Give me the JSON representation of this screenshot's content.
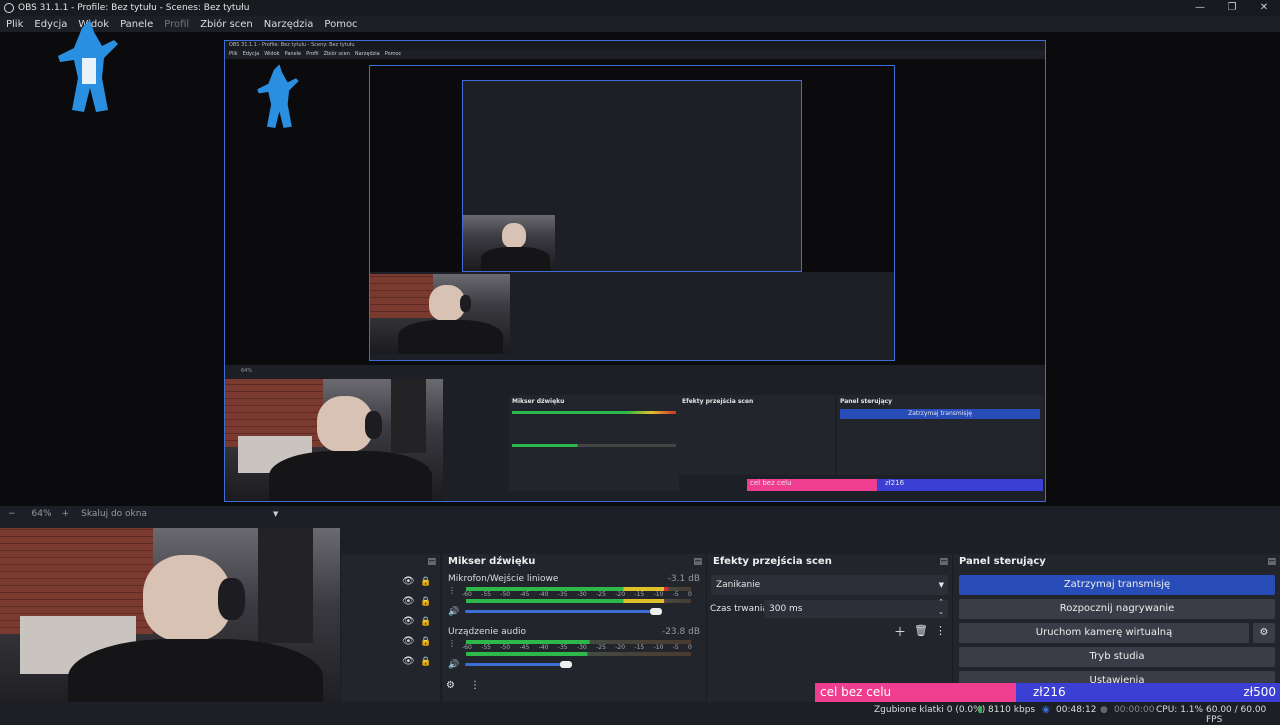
{
  "window": {
    "title": "OBS 31.1.1 - Profile: Bez tytułu - Scenes: Bez tytułu"
  },
  "menu": [
    "Plik",
    "Edycja",
    "Widok",
    "Panele",
    "Profil",
    "Zbiór scen",
    "Narzędzia",
    "Pomoc"
  ],
  "nested_title": "OBS 31.1.1 - Profile: Bez tytułu - Sceny: Bez tytułu",
  "nested_menu": [
    "Plik",
    "Edycja",
    "Widok",
    "Panele",
    "Profil",
    "Zbiór scen",
    "Narzędzia",
    "Pomoc"
  ],
  "zoom": {
    "value": "64%",
    "label": "Skaluj do okna"
  },
  "mixer": {
    "title": "Mikser dźwięku",
    "channels": [
      {
        "name": "Mikrofon/Wejście liniowe",
        "db": "-3.1 dB",
        "level": 0.9,
        "volume": 0.85
      },
      {
        "name": "Urządzenie audio",
        "db": "-23.8 dB",
        "level": 0.55,
        "volume": 0.45
      }
    ],
    "scale": [
      "-60",
      "-55",
      "-50",
      "-45",
      "-40",
      "-35",
      "-30",
      "-25",
      "-20",
      "-15",
      "-10",
      "-5",
      "0"
    ]
  },
  "transitions": {
    "title": "Efekty przejścia scen",
    "selected": "Zanikanie",
    "duration_label": "Czas trwania",
    "duration_value": "300 ms"
  },
  "controls": {
    "title": "Panel sterujący",
    "buttons": [
      "Zatrzymaj transmisję",
      "Rozpocznij nagrywanie",
      "Uruchom kamerę wirtualną",
      "Tryb studia",
      "Ustawienia"
    ]
  },
  "goal": {
    "label": "cel bez celu",
    "current": "zł216",
    "target": "zł500"
  },
  "status": {
    "dropped": "Zgubione klatki 0 (0.0%)",
    "bitrate": "8110 kbps",
    "stream_time": "00:48:12",
    "rec_time": "00:00:00",
    "cpu": "CPU: 1.1%",
    "fps": "60.00 / 60.00 FPS"
  },
  "colors": {
    "accent": "#284cb8",
    "goal_pink": "#ef3d8f",
    "goal_blue": "#3b3fd4"
  }
}
